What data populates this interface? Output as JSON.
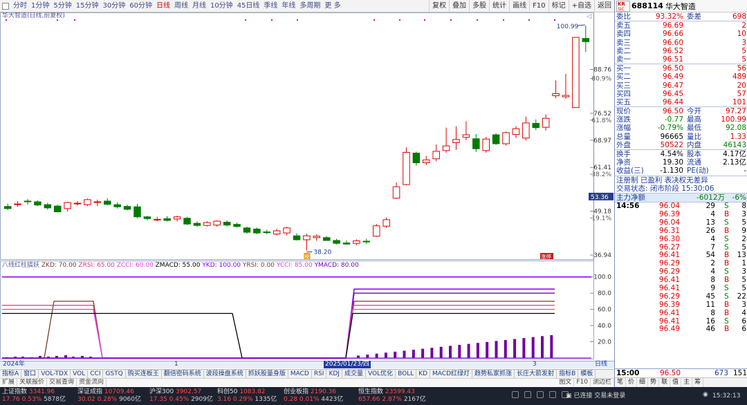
{
  "toolbar": {
    "periods": [
      "分时",
      "1分钟",
      "5分钟",
      "15分钟",
      "30分钟",
      "60分钟",
      "日线",
      "周线",
      "月线",
      "10分钟",
      "45日线",
      "季线",
      "年线",
      "多周期",
      "更 多"
    ],
    "active_period": "日线",
    "right_buttons": [
      "复权",
      "叠加",
      "多股",
      "统计",
      "画线",
      "F10",
      "标记",
      "+自选",
      "返回"
    ]
  },
  "chart": {
    "header": "华大智造(日线,前复权)",
    "price_axis": [
      "100.99",
      "88.76",
      "80.9%",
      "76.52",
      "61.8%",
      "68.97",
      "61.41",
      "38.2%",
      "53.36",
      "49.18",
      "19.1%",
      "36.94"
    ],
    "high_label": "100.99",
    "low_label": "38.20",
    "current_price_tag": "53.36",
    "marker_label": "涨停",
    "low_marker": "榜",
    "date_labels": [
      "2024年",
      "1",
      "2025/01/23/四",
      "3"
    ],
    "period_label": "日线"
  },
  "indicator": {
    "title": "八线红柱搞妖",
    "values_text": [
      {
        "k": "ZKD:",
        "v": "70.00",
        "c": "#7a3a2a"
      },
      {
        "k": "ZRSI:",
        "v": "65.00",
        "c": "#e03088"
      },
      {
        "k": "ZCCI:",
        "v": "60.00",
        "c": "#e040e0"
      },
      {
        "k": "ZMACD:",
        "v": "55.00",
        "c": "#000000"
      },
      {
        "k": "YKD:",
        "v": "100.00",
        "c": "#9000ff"
      },
      {
        "k": "YRSI:",
        "v": "0.00",
        "c": "#7a3a2a"
      },
      {
        "k": "YCCI:",
        "v": "85.00",
        "c": "#e040e0"
      },
      {
        "k": "YMACD:",
        "v": "80.00",
        "c": "#7000c0"
      }
    ],
    "axis": [
      "100.0",
      "80.0",
      "60.0",
      "40.0",
      "20.0"
    ]
  },
  "chart_data": {
    "type": "candlestick",
    "title": "华大智造(日线,前复权)",
    "ylim": [
      36.94,
      100.99
    ],
    "candles": [
      {
        "o": 50.5,
        "h": 51.3,
        "l": 49.5,
        "c": 49.9
      },
      {
        "o": 51.1,
        "h": 52.0,
        "l": 50.4,
        "c": 51.2
      },
      {
        "o": 52.0,
        "h": 52.6,
        "l": 51.0,
        "c": 51.9
      },
      {
        "o": 51.8,
        "h": 52.2,
        "l": 50.6,
        "c": 50.9
      },
      {
        "o": 51.0,
        "h": 51.5,
        "l": 49.6,
        "c": 50.1
      },
      {
        "o": 50.6,
        "h": 51.0,
        "l": 48.8,
        "c": 49.0
      },
      {
        "o": 49.9,
        "h": 51.8,
        "l": 49.1,
        "c": 51.6
      },
      {
        "o": 51.3,
        "h": 52.0,
        "l": 50.8,
        "c": 51.4
      },
      {
        "o": 51.0,
        "h": 52.7,
        "l": 50.6,
        "c": 52.4
      },
      {
        "o": 51.6,
        "h": 52.4,
        "l": 50.6,
        "c": 51.8
      },
      {
        "o": 52.0,
        "h": 52.8,
        "l": 50.8,
        "c": 51.1
      },
      {
        "o": 51.0,
        "h": 51.6,
        "l": 49.9,
        "c": 50.4
      },
      {
        "o": 50.5,
        "h": 51.0,
        "l": 49.4,
        "c": 49.7
      },
      {
        "o": 50.4,
        "h": 51.2,
        "l": 47.2,
        "c": 47.6
      },
      {
        "o": 47.6,
        "h": 47.9,
        "l": 46.6,
        "c": 47.1
      },
      {
        "o": 46.9,
        "h": 47.6,
        "l": 46.4,
        "c": 46.9
      },
      {
        "o": 47.1,
        "h": 47.8,
        "l": 46.3,
        "c": 46.6
      },
      {
        "o": 47.0,
        "h": 47.9,
        "l": 46.3,
        "c": 47.6
      },
      {
        "o": 47.2,
        "h": 47.6,
        "l": 45.3,
        "c": 45.6
      },
      {
        "o": 45.8,
        "h": 46.3,
        "l": 44.8,
        "c": 45.2
      },
      {
        "o": 45.2,
        "h": 46.4,
        "l": 44.9,
        "c": 46.0
      },
      {
        "o": 45.3,
        "h": 46.6,
        "l": 44.8,
        "c": 46.4
      },
      {
        "o": 46.1,
        "h": 46.6,
        "l": 44.9,
        "c": 45.3
      },
      {
        "o": 45.5,
        "h": 46.0,
        "l": 44.6,
        "c": 44.9
      },
      {
        "o": 44.5,
        "h": 44.9,
        "l": 42.9,
        "c": 43.3
      },
      {
        "o": 44.2,
        "h": 44.6,
        "l": 42.7,
        "c": 43.1
      },
      {
        "o": 43.4,
        "h": 44.0,
        "l": 42.7,
        "c": 43.2
      },
      {
        "o": 42.8,
        "h": 44.3,
        "l": 42.4,
        "c": 43.7
      },
      {
        "o": 43.1,
        "h": 44.8,
        "l": 42.4,
        "c": 44.5
      },
      {
        "o": 42.3,
        "h": 43.0,
        "l": 41.0,
        "c": 41.2
      },
      {
        "o": 41.2,
        "h": 42.9,
        "l": 38.2,
        "c": 42.3
      },
      {
        "o": 41.8,
        "h": 42.7,
        "l": 40.9,
        "c": 42.2
      },
      {
        "o": 41.8,
        "h": 42.2,
        "l": 40.9,
        "c": 41.0
      },
      {
        "o": 41.0,
        "h": 41.5,
        "l": 39.9,
        "c": 40.2
      },
      {
        "o": 40.3,
        "h": 41.0,
        "l": 39.8,
        "c": 40.0
      },
      {
        "o": 40.2,
        "h": 41.3,
        "l": 39.7,
        "c": 40.9
      },
      {
        "o": 40.8,
        "h": 41.5,
        "l": 40.0,
        "c": 40.6
      },
      {
        "o": 42.2,
        "h": 45.6,
        "l": 42.0,
        "c": 45.1
      },
      {
        "o": 45.0,
        "h": 47.4,
        "l": 44.5,
        "c": 46.8
      },
      {
        "o": 52.8,
        "h": 57.2,
        "l": 52.6,
        "c": 56.0
      },
      {
        "o": 56.6,
        "h": 67.0,
        "l": 56.4,
        "c": 65.6
      },
      {
        "o": 65.4,
        "h": 65.8,
        "l": 61.9,
        "c": 62.7
      },
      {
        "o": 62.7,
        "h": 64.6,
        "l": 62.0,
        "c": 63.5
      },
      {
        "o": 63.8,
        "h": 67.8,
        "l": 63.1,
        "c": 65.9
      },
      {
        "o": 66.1,
        "h": 72.5,
        "l": 65.5,
        "c": 67.4
      },
      {
        "o": 68.3,
        "h": 72.9,
        "l": 66.3,
        "c": 69.2
      },
      {
        "o": 69.8,
        "h": 74.3,
        "l": 69.0,
        "c": 70.5
      },
      {
        "o": 69.4,
        "h": 70.7,
        "l": 65.7,
        "c": 66.6
      },
      {
        "o": 66.1,
        "h": 69.9,
        "l": 65.5,
        "c": 69.3
      },
      {
        "o": 70.5,
        "h": 70.9,
        "l": 67.7,
        "c": 68.0
      },
      {
        "o": 68.0,
        "h": 71.4,
        "l": 67.5,
        "c": 71.1
      },
      {
        "o": 70.6,
        "h": 72.9,
        "l": 69.6,
        "c": 72.2
      },
      {
        "o": 69.6,
        "h": 75.6,
        "l": 68.9,
        "c": 73.8
      },
      {
        "o": 73.7,
        "h": 74.8,
        "l": 71.8,
        "c": 72.5
      },
      {
        "o": 72.6,
        "h": 76.2,
        "l": 71.7,
        "c": 75.1
      },
      {
        "o": 81.4,
        "h": 85.7,
        "l": 80.7,
        "c": 82.0
      },
      {
        "o": 81.1,
        "h": 87.5,
        "l": 80.6,
        "c": 81.5
      },
      {
        "o": 78.1,
        "h": 97.7,
        "l": 78.1,
        "c": 97.7
      },
      {
        "o": 97.4,
        "h": 100.99,
        "l": 93.6,
        "c": 96.5
      }
    ]
  },
  "quote": {
    "code": "688114",
    "name": "华大智造",
    "logo_top": "KR",
    "logo_bottom": "SIC",
    "weibi_label": "委比",
    "weibi_value": "93.32%",
    "weicha_label": "委差",
    "weicha_value": "698",
    "asks": [
      {
        "label": "卖五",
        "price": "96.69",
        "vol": "2"
      },
      {
        "label": "卖四",
        "price": "96.66",
        "vol": "10"
      },
      {
        "label": "卖三",
        "price": "96.60",
        "vol": "3"
      },
      {
        "label": "卖二",
        "price": "96.52",
        "vol": "5"
      },
      {
        "label": "卖一",
        "price": "96.51",
        "vol": "5"
      }
    ],
    "bids": [
      {
        "label": "买一",
        "price": "96.50",
        "vol": "56"
      },
      {
        "label": "买二",
        "price": "96.49",
        "vol": "489"
      },
      {
        "label": "买三",
        "price": "96.47",
        "vol": "20"
      },
      {
        "label": "买四",
        "price": "96.45",
        "vol": "57"
      },
      {
        "label": "买五",
        "price": "96.44",
        "vol": "101"
      }
    ],
    "stats": [
      {
        "l1": "现价",
        "v1": "96.50",
        "c1": "red",
        "l2": "今开",
        "v2": "97.27",
        "c2": "red"
      },
      {
        "l1": "涨跌",
        "v1": "-0.77",
        "c1": "grn",
        "l2": "最高",
        "v2": "100.99",
        "c2": "red"
      },
      {
        "l1": "涨幅",
        "v1": "-0.79%",
        "c1": "grn",
        "l2": "最低",
        "v2": "92.08",
        "c2": "grn"
      },
      {
        "l1": "总量",
        "v1": "96665",
        "c1": "blk",
        "l2": "量比",
        "v2": "1.33",
        "c2": "red"
      },
      {
        "l1": "外盘",
        "v1": "50522",
        "c1": "red",
        "l2": "内盘",
        "v2": "46143",
        "c2": "grn"
      }
    ],
    "fin": [
      {
        "l1": "换手",
        "v1": "4.54%",
        "l2": "股本",
        "v2": "4.17亿"
      },
      {
        "l1": "净资",
        "v1": "19.30",
        "l2": "流通",
        "v2": "2.13亿"
      },
      {
        "l1": "收益(三)",
        "v1": "-1.130",
        "l2": "PE(动)",
        "v2": "-"
      }
    ],
    "register": "注册制 已盈利 表决权无差异",
    "trade_state": "交易状态: 闭市阶段 15:30:06",
    "mainflow_label": "主力净额",
    "mainflow_value": "-6012万",
    "mainflow_pct": "-6%",
    "first_time": "14:56",
    "trades": [
      {
        "p": "96.04",
        "v": "29",
        "s": "S",
        "n": "8"
      },
      {
        "p": "96.39",
        "v": "4",
        "s": "B",
        "n": "3"
      },
      {
        "p": "96.04",
        "v": "13",
        "s": "S",
        "n": "5"
      },
      {
        "p": "96.31",
        "v": "26",
        "s": "B",
        "n": "9"
      },
      {
        "p": "96.30",
        "v": "4",
        "s": "S",
        "n": "2"
      },
      {
        "p": "96.27",
        "v": "7",
        "s": "S",
        "n": "5"
      },
      {
        "p": "96.41",
        "v": "54",
        "s": "B",
        "n": "13"
      },
      {
        "p": "96.29",
        "v": "2",
        "s": "B",
        "n": "1"
      },
      {
        "p": "96.29",
        "v": "4",
        "s": "S",
        "n": "3"
      },
      {
        "p": "96.41",
        "v": "8",
        "s": "B",
        "n": "5"
      },
      {
        "p": "96.41",
        "v": "9",
        "s": "S",
        "n": "5"
      },
      {
        "p": "96.29",
        "v": "45",
        "s": "S",
        "n": "22"
      },
      {
        "p": "96.39",
        "v": "11",
        "s": "B",
        "n": "3"
      },
      {
        "p": "96.41",
        "v": "8",
        "s": "B",
        "n": "4"
      },
      {
        "p": "96.41",
        "v": "16",
        "s": "S",
        "n": "6"
      },
      {
        "p": "96.49",
        "v": "46",
        "s": "B",
        "n": "6"
      }
    ],
    "last_trade": {
      "t": "15:00",
      "p": "96.50",
      "v": "673",
      "n": "151"
    },
    "foot_tabs": [
      "笔",
      "价",
      "细",
      "势",
      "联",
      "值",
      "主",
      "筹"
    ]
  },
  "bottom_tabs": [
    "指标A",
    "窗口",
    "VOL-TDX",
    "VOL",
    "CCI",
    "GSTQ",
    "购买连板王",
    "翻倍密码系统",
    "波段操盘系统",
    "抓妖股量身版",
    "MACD",
    "RSI",
    "KDJ",
    "成交量",
    "VOL优化",
    "BOLL",
    "KD",
    "MACD红绿灯",
    "趋势私家抓涨",
    "长庄大箭发射",
    "指标B",
    "模板"
  ],
  "bottom_tabs2": [
    "扩展",
    "关联报价",
    "交易查询",
    "资金流向"
  ],
  "right_tabs2": [
    "图文",
    "F10",
    "测边栏"
  ],
  "status": {
    "indices": [
      {
        "name": "上证指数",
        "val": "3341.96",
        "chg": "17.76",
        "pct": "0.53%",
        "amt": "5878亿"
      },
      {
        "name": "深证成指",
        "val": "10709.46",
        "chg": "30.02",
        "pct": "0.28%",
        "amt": "9060亿"
      },
      {
        "name": "沪深300",
        "val": "3902.57",
        "chg": "17.35",
        "pct": "0.45%",
        "amt": "2909亿"
      },
      {
        "name": "科创50",
        "val": "1083.82",
        "chg": "3.16",
        "pct": "0.29%",
        "amt": "1335亿"
      },
      {
        "name": "创业板指",
        "val": "2190.36",
        "chg": "0.28",
        "pct": "0.01%",
        "amt": "4423亿"
      },
      {
        "name": "恒生指数",
        "val": "23599.43",
        "chg": "657.66",
        "pct": "2.87%",
        "amt": "2167亿"
      }
    ],
    "connected": "已连接 交易未登录",
    "time": "15:32:13"
  }
}
